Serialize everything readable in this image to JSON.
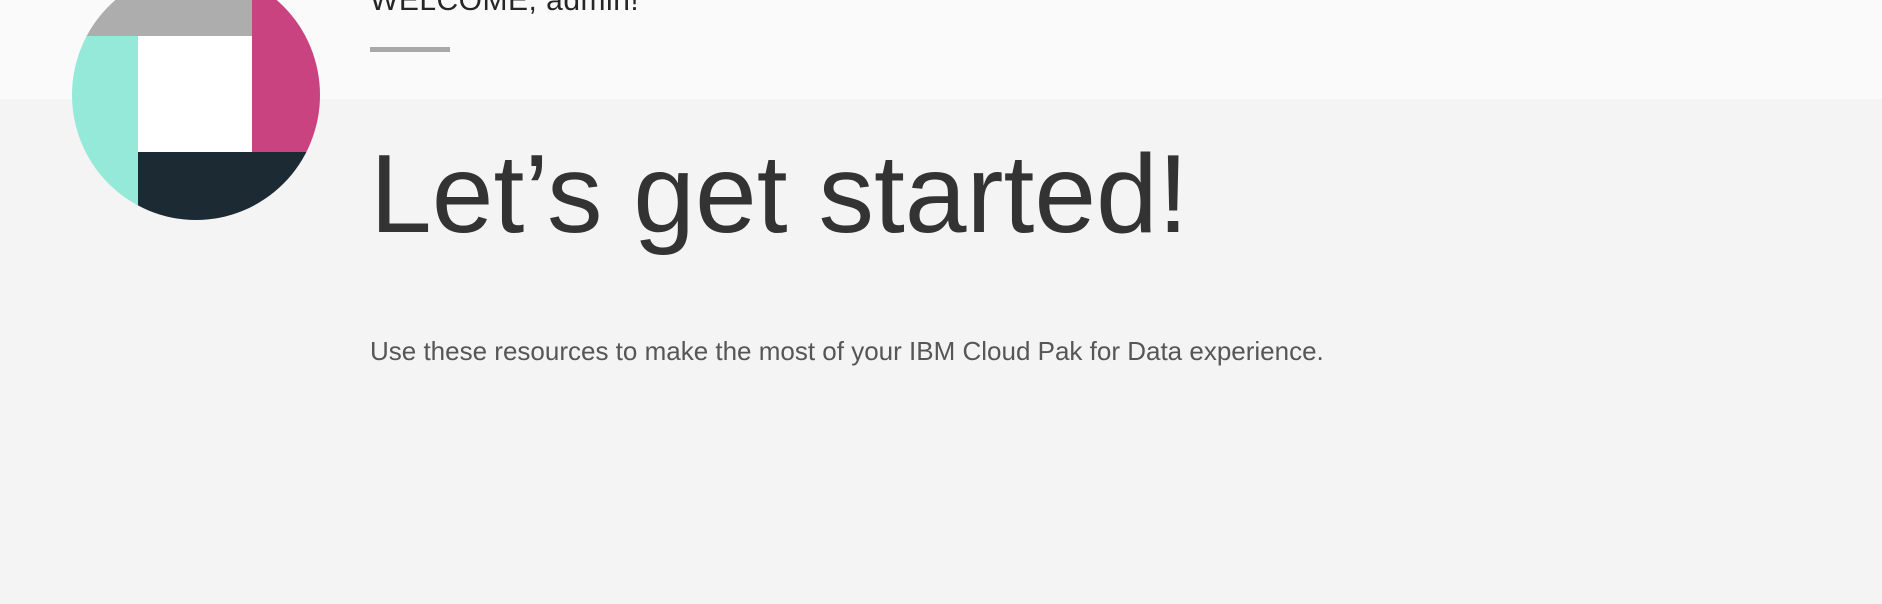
{
  "header": {
    "welcome_text": "WELCOME, admin!"
  },
  "hero": {
    "title": "Let’s get started!",
    "subtitle": "Use these resources to make the most of your IBM Cloud Pak for Data experience."
  },
  "colors": {
    "background": "#f4f4f4",
    "top_band": "#fafafa",
    "avatar_gray": "#adadad",
    "avatar_teal": "#95e9d8",
    "avatar_pink": "#c84380",
    "avatar_navy": "#1b2a33",
    "avatar_white": "#ffffff"
  },
  "avatar": {
    "icon": "profile-graphic-icon"
  }
}
